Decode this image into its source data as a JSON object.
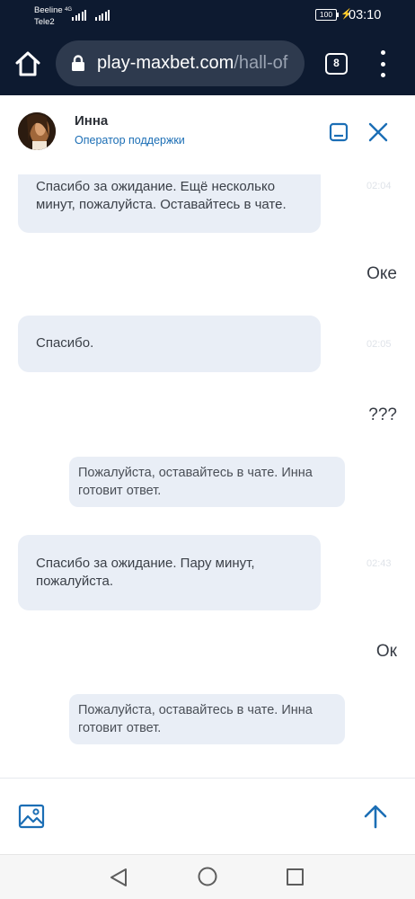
{
  "status_bar": {
    "carrier_1": "Beeline",
    "carrier_2": "Tele2",
    "network_type": "4G",
    "battery": "100",
    "time": "03:10"
  },
  "browser": {
    "url_main": "play-maxbet.com",
    "url_tail": "/hall-of",
    "tab_count": "8",
    "icons": [
      "home-icon",
      "lock-icon",
      "tab-switcher-icon",
      "more-vert-icon"
    ]
  },
  "chat_header": {
    "agent_name": "Инна",
    "agent_role": "Оператор поддержки",
    "icons": [
      "minimize-icon",
      "close-icon"
    ]
  },
  "messages": [
    {
      "type": "operator",
      "text": "Спасибо за ожидание. Ещё несколько минут, пожалуйста. Оставайтесь в чате.",
      "time": "02:04"
    },
    {
      "type": "user",
      "text": "Оке"
    },
    {
      "type": "operator",
      "text": "Спасибо.",
      "time": "02:05"
    },
    {
      "type": "user",
      "text": "???"
    },
    {
      "type": "system",
      "text": "Пожалуйста, оставайтесь в чате. Инна готовит ответ."
    },
    {
      "type": "operator",
      "text": "Спасибо за ожидание. Пару минут, пожалуйста.",
      "time": "02:43"
    },
    {
      "type": "user",
      "text": "Ок"
    },
    {
      "type": "system",
      "text": "Пожалуйста, оставайтесь в чате. Инна готовит ответ."
    }
  ],
  "composer": {
    "icons": [
      "image-attach-icon",
      "send-arrow-icon"
    ]
  },
  "nav_bar": {
    "icons": [
      "back-triangle-icon",
      "home-circle-icon",
      "recent-apps-icon"
    ]
  },
  "colors": {
    "bar_bg": "#0d1a30",
    "url_box": "#2e3a4e",
    "accent_blue": "#1b6eb5",
    "bubble_bg": "#e9eef6"
  }
}
